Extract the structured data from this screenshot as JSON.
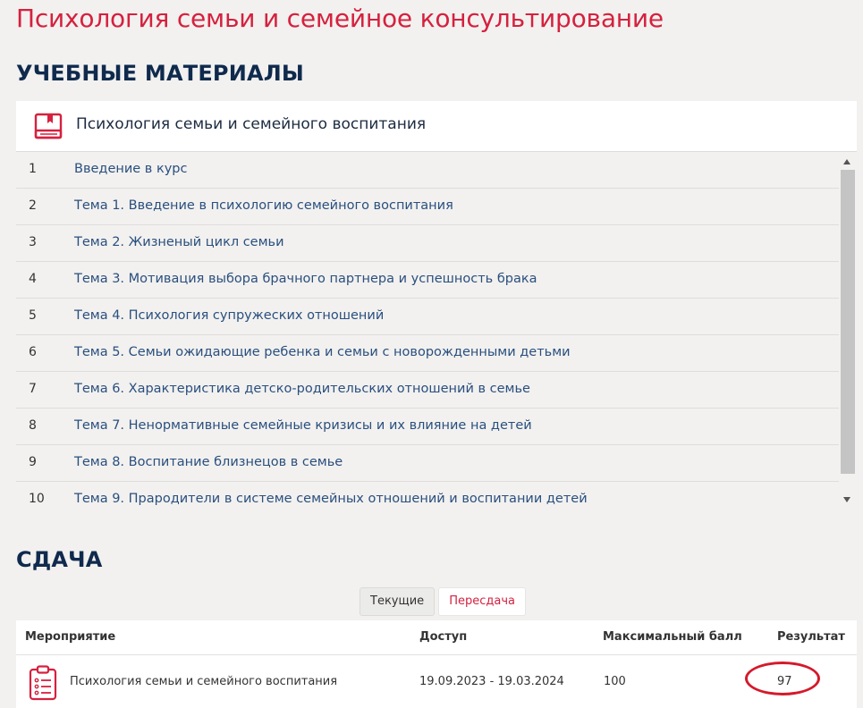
{
  "page": {
    "title": "Психология семьи и семейное консультирование"
  },
  "materials": {
    "section_title": "УЧЕБНЫЕ МАТЕРИАЛЫ",
    "course_icon": "book-icon",
    "course_name": "Психология семьи и семейного воспитания",
    "topics": [
      {
        "num": "1",
        "label": "Введение в курс"
      },
      {
        "num": "2",
        "label": "Тема 1. Введение в психологию семейного воспитания"
      },
      {
        "num": "3",
        "label": "Тема 2. Жизненый цикл семьи"
      },
      {
        "num": "4",
        "label": "Тема 3. Мотивация выбора брачного партнера и успешность брака"
      },
      {
        "num": "5",
        "label": "Тема 4. Психология супружеских отношений"
      },
      {
        "num": "6",
        "label": "Тема 5. Семьи ожидающие ребенка и семьи с новорожденными детьми"
      },
      {
        "num": "7",
        "label": "Тема 6. Характеристика детско-родительских отношений в семье"
      },
      {
        "num": "8",
        "label": "Тема 7. Ненормативные семейные кризисы и их влияние на детей"
      },
      {
        "num": "9",
        "label": "Тема 8. Воспитание близнецов в семье"
      },
      {
        "num": "10",
        "label": "Тема 9. Прародители в системе семейных отношений и воспитании детей"
      }
    ]
  },
  "submission": {
    "section_title": "СДАЧА",
    "tabs": [
      {
        "label": "Текущие",
        "active": false
      },
      {
        "label": "Пересдача",
        "active": true
      }
    ],
    "columns": [
      "Мероприятие",
      "Доступ",
      "Максимальный балл",
      "Результат"
    ],
    "rows": [
      {
        "icon": "clipboard-list-icon",
        "event": "Психология семьи и семейного воспитания",
        "access": "19.09.2023 - 19.03.2024",
        "max_score": "100",
        "result": "97"
      }
    ]
  },
  "colors": {
    "accent_red": "#d5213f",
    "heading_navy": "#0f2a4d",
    "link_blue": "#2a4f7f",
    "annotation_red": "#d41a2b"
  }
}
